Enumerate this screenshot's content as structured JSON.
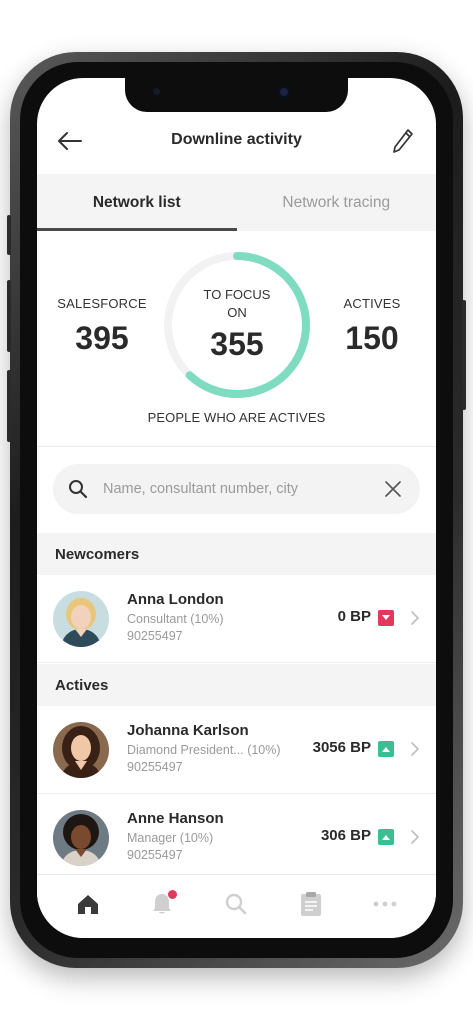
{
  "header": {
    "title": "Downline activity"
  },
  "tabs": [
    {
      "label": "Network list",
      "active": true
    },
    {
      "label": "Network tracing",
      "active": false
    }
  ],
  "stats": {
    "salesforce": {
      "label": "SALESFORCE",
      "value": "395"
    },
    "focus": {
      "label": "TO FOCUS ON",
      "value": "355",
      "progress": 0.62
    },
    "actives": {
      "label": "ACTIVES",
      "value": "150"
    },
    "caption": "PEOPLE WHO ARE ACTIVES"
  },
  "search": {
    "placeholder": "Name, consultant number, city",
    "value": ""
  },
  "sections": {
    "newcomers": "Newcomers",
    "actives": "Actives"
  },
  "people": [
    {
      "name": "Anna London",
      "role": "Consultant (10%)",
      "id": "90255497",
      "bp": "0 BP",
      "trend": "down"
    },
    {
      "name": "Johanna Karlson",
      "role": "Diamond President... (10%)",
      "id": "90255497",
      "bp": "3056 BP",
      "trend": "up"
    },
    {
      "name": "Anne Hanson",
      "role": "Manager (10%)",
      "id": "90255497",
      "bp": "306 BP",
      "trend": "up"
    }
  ],
  "colors": {
    "accent": "#7fdcc0",
    "ring_track": "#f2f2f2",
    "trend_down": "#e2385c",
    "trend_up": "#3dbd92",
    "notification": "#e2385c"
  },
  "nav": [
    {
      "icon": "home-icon",
      "active": true
    },
    {
      "icon": "bell-icon",
      "active": false,
      "notification": true
    },
    {
      "icon": "search-icon",
      "active": false
    },
    {
      "icon": "clipboard-icon",
      "active": false
    },
    {
      "icon": "more-icon",
      "active": false
    }
  ]
}
